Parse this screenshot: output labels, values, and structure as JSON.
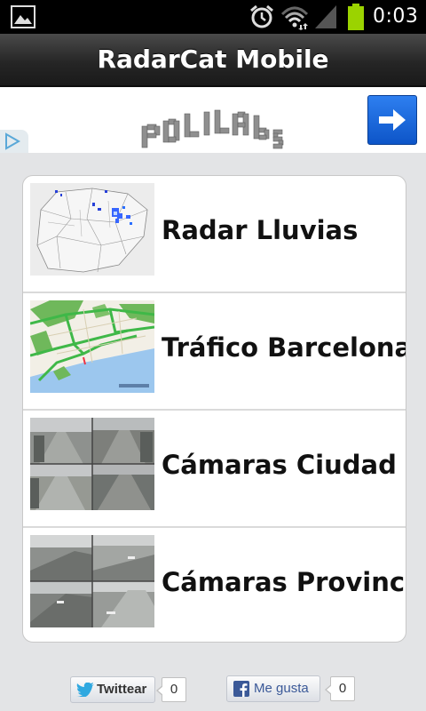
{
  "status_bar": {
    "time": "0:03",
    "icons": [
      "image-icon",
      "alarm-icon",
      "wifi-icon",
      "signal-icon",
      "battery-icon"
    ]
  },
  "app_bar": {
    "title": "RadarCat Mobile"
  },
  "ad_banner": {
    "brand_text": "POLILAbs",
    "arrow_button_icon": "arrow-right-icon"
  },
  "menu": {
    "items": [
      {
        "label": "Radar Lluvias",
        "thumb": "radar-map"
      },
      {
        "label": "Tráfico Barcelona",
        "thumb": "traffic-map"
      },
      {
        "label": "Cámaras Ciudad",
        "thumb": "city-cameras"
      },
      {
        "label": "Cámaras Provincia",
        "thumb": "province-cameras"
      }
    ]
  },
  "social": {
    "twitter": {
      "label": "Twittear",
      "count": "0"
    },
    "facebook": {
      "label": "Me gusta",
      "count": "0"
    }
  },
  "colors": {
    "app_bar": "#262626",
    "ad_button": "#1565d8",
    "background": "#e3e4e6"
  }
}
